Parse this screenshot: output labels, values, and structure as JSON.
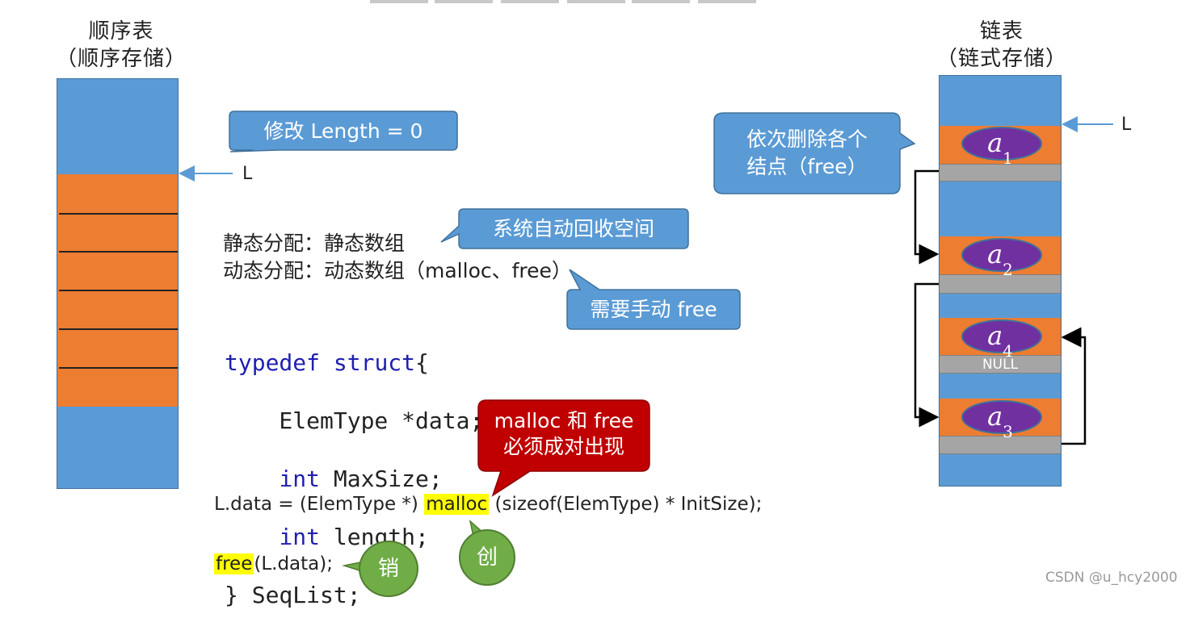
{
  "seq_title": [
    "顺序表",
    "（顺序存储）"
  ],
  "link_title": [
    "链表",
    "（链式存储）"
  ],
  "pointer_label_seq": "L",
  "pointer_label_link": "L",
  "bubble_length": "修改 Length = 0",
  "bubble_delete": [
    "依次删除各个",
    "结点（free）"
  ],
  "bubble_auto": "系统自动回收空间",
  "bubble_manual": "需要手动 free",
  "bubble_pair": [
    "malloc 和 free",
    "必须成对出现"
  ],
  "static_line": "静态分配：静态数组",
  "dynamic_line": "动态分配：动态数组（malloc、free）",
  "code": {
    "l1_kw1": "typedef",
    "l1_kw2": "struct",
    "l1_rest": "{",
    "l2": "    ElemType *data;",
    "l3_kw": "int",
    "l3_rest": " MaxSize;",
    "l4_kw": "int",
    "l4_rest": " length;",
    "l5": "} SeqList;"
  },
  "malloc_stmt": {
    "pre": "L.data = (ElemType *) ",
    "fn": "malloc",
    "post": " (sizeof(ElemType) * InitSize);"
  },
  "free_stmt": {
    "fn": "free",
    "post": "(L.data);"
  },
  "circle_create": "创",
  "circle_destroy": "销",
  "nodes": [
    {
      "letter": "a",
      "sub": "1"
    },
    {
      "letter": "a",
      "sub": "2"
    },
    {
      "letter": "a",
      "sub": "4"
    },
    {
      "letter": "a",
      "sub": "3"
    }
  ],
  "null_label": "NULL",
  "watermark": "CSDN @u_hcy2000",
  "colors": {
    "blue": "#5b9bd5",
    "orange": "#ed7d31",
    "gray": "#a5a5a5",
    "purple": "#7030a0",
    "red": "#c00000",
    "green": "#70ad47"
  }
}
